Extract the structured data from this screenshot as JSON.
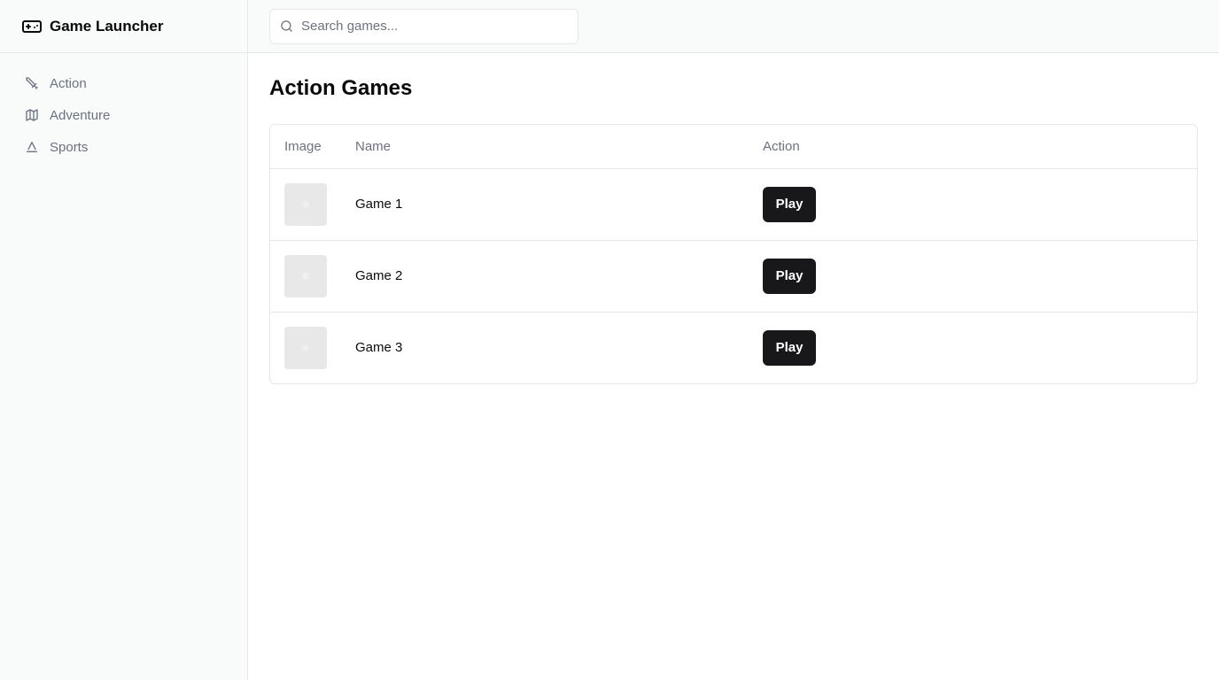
{
  "app": {
    "title": "Game Launcher",
    "brand_icon": "gamepad-icon"
  },
  "sidebar": {
    "items": [
      {
        "label": "Action",
        "icon": "sword-icon"
      },
      {
        "label": "Adventure",
        "icon": "map-icon"
      },
      {
        "label": "Sports",
        "icon": "triangle-icon"
      }
    ]
  },
  "search": {
    "placeholder": "Search games...",
    "value": ""
  },
  "main": {
    "title": "Action Games"
  },
  "table": {
    "headers": [
      "Image",
      "Name",
      "Action"
    ],
    "rows": [
      {
        "name": "Game 1",
        "action_label": "Play"
      },
      {
        "name": "Game 2",
        "action_label": "Play"
      },
      {
        "name": "Game 3",
        "action_label": "Play"
      }
    ]
  },
  "colors": {
    "sidebar_bg": "#f9fafa",
    "muted_text": "#6b7280",
    "button_bg": "#18181b",
    "button_text": "#ffffff",
    "border": "#e5e7eb"
  }
}
